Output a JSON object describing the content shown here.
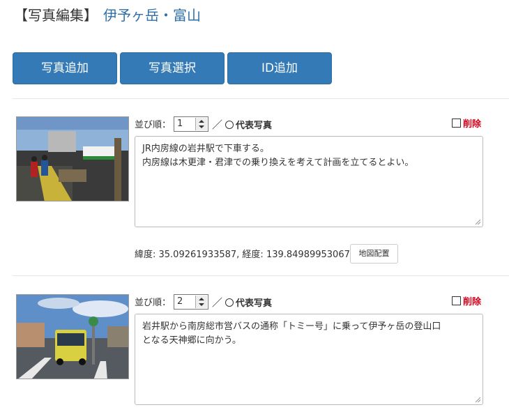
{
  "header": {
    "bracket_title": "【写真編集】",
    "mountain_name": "伊予ヶ岳・富山"
  },
  "toolbar": {
    "add_photo_label": "写真追加",
    "select_photo_label": "写真選択",
    "add_id_label": "ID追加"
  },
  "labels": {
    "order": "並び順：",
    "separator": "／",
    "representative": "代表写真",
    "delete": "削除",
    "map_button": "地図配置"
  },
  "photos": [
    {
      "order": "1",
      "caption_line1": "JR内房線の岩井駅で下車する。",
      "caption_line2": "内房線は木更津・君津での乗り換えを考えて計画を立てるとよい。",
      "coords_text": "緯度: 35.09261933587, 経度: 139.84989953067"
    },
    {
      "order": "2",
      "caption_line1": "岩井駅から南房総市営バスの通称「トミー号」に乗って伊予ヶ岳の登山口",
      "caption_line2": "となる天神郷に向かう。"
    }
  ]
}
